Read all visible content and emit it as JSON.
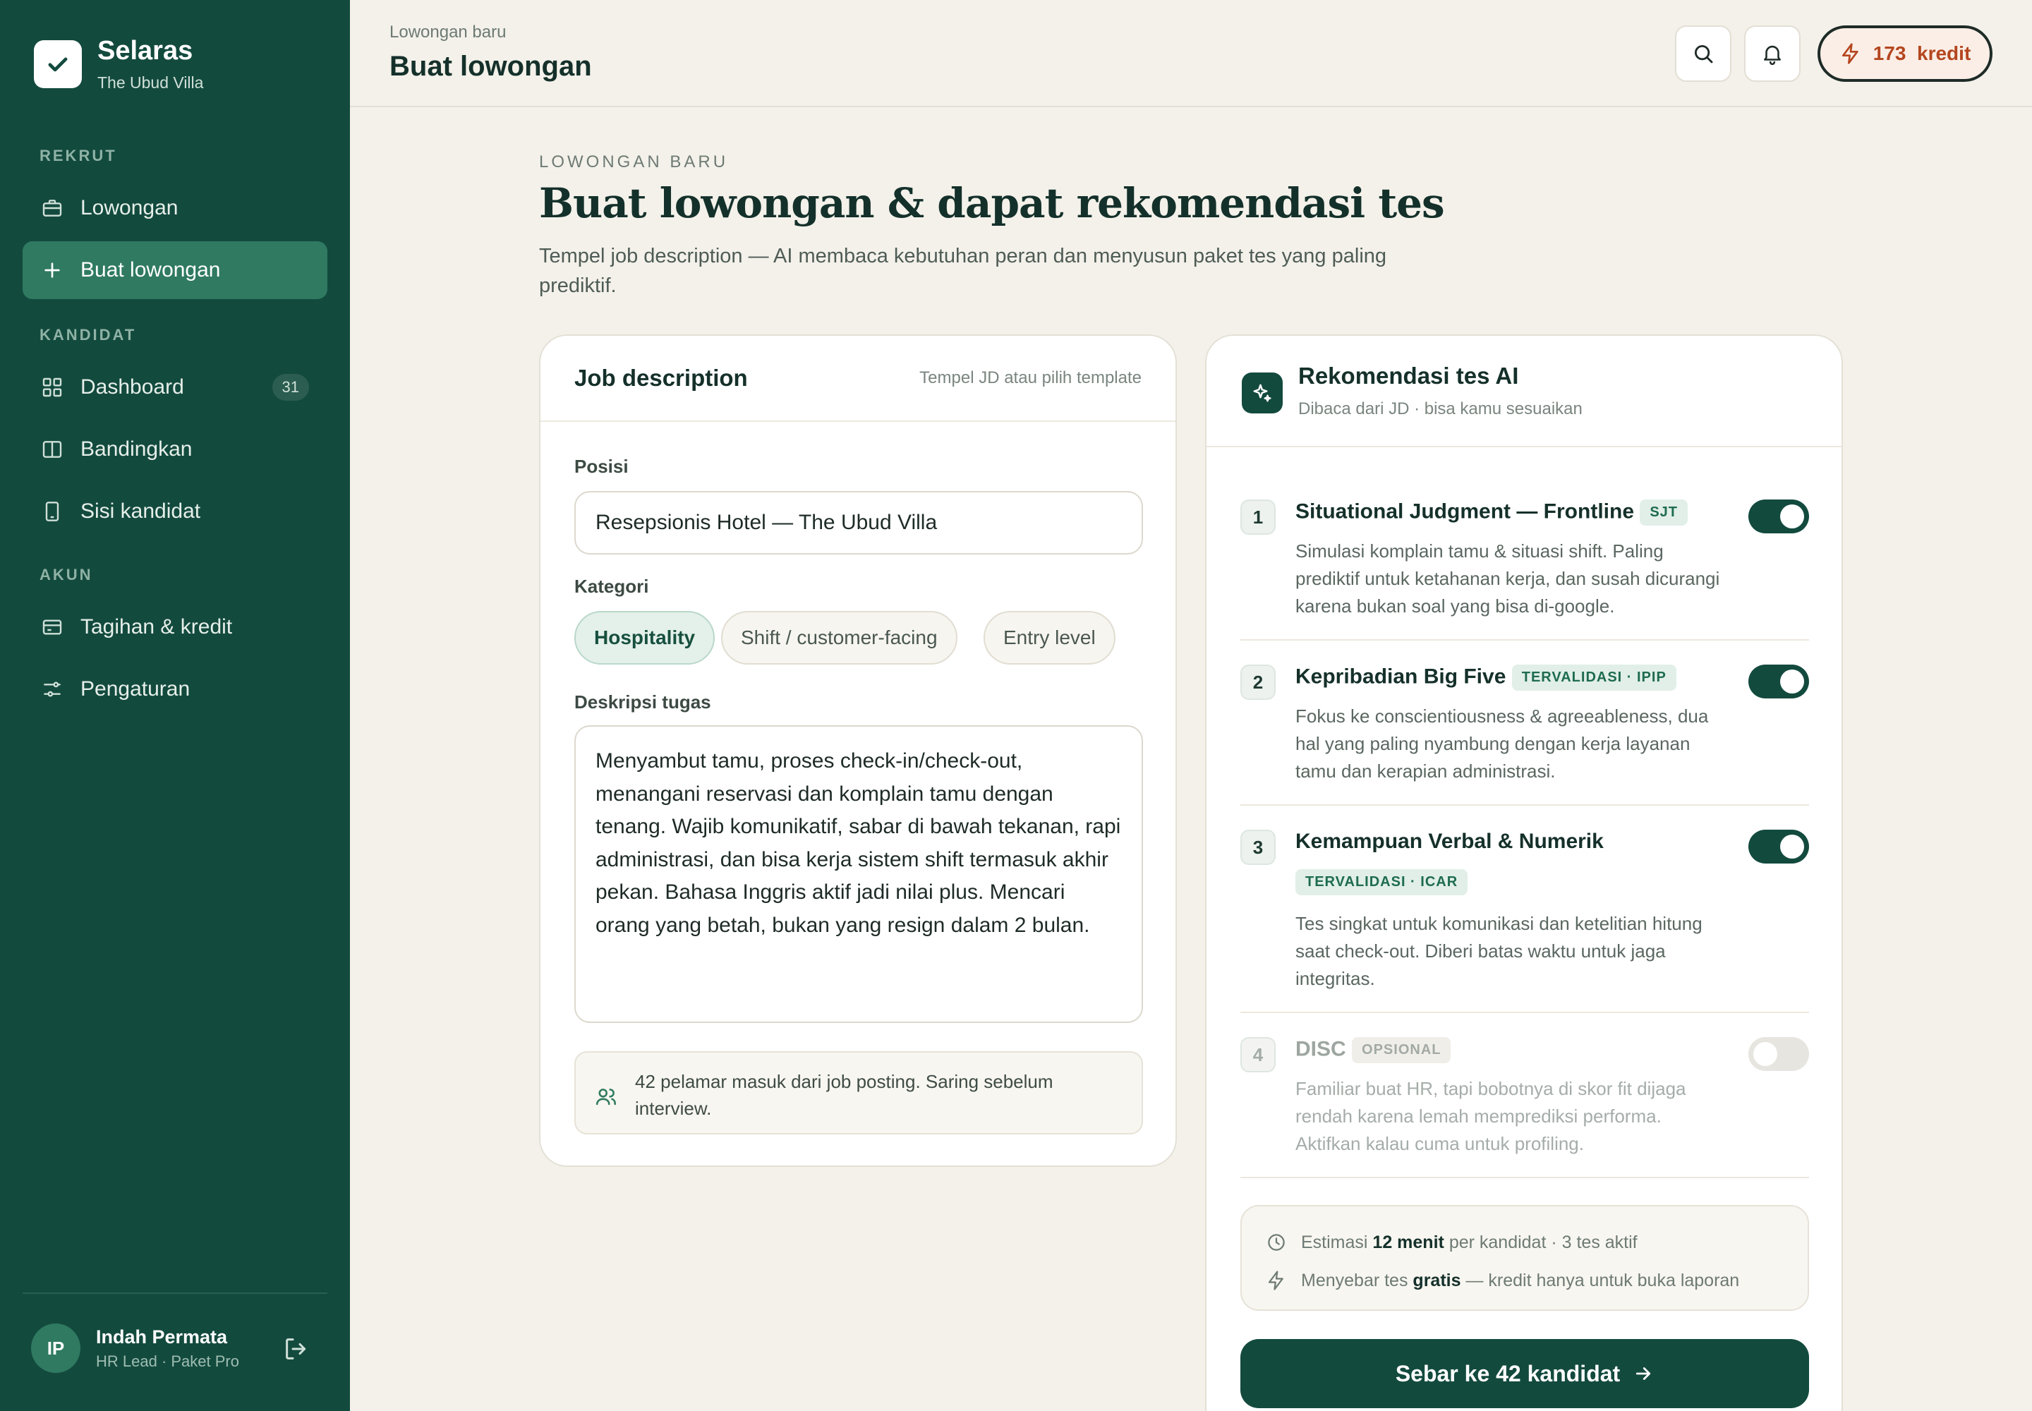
{
  "brand": {
    "name": "Selaras",
    "subtitle": "The Ubud Villa"
  },
  "sidebar": {
    "sections": [
      "REKRUT",
      "KANDIDAT",
      "AKUN"
    ],
    "items": [
      {
        "label": "Lowongan",
        "icon": "briefcase-icon"
      },
      {
        "label": "Buat lowongan",
        "icon": "plus-icon",
        "active": true
      },
      {
        "label": "Dashboard",
        "icon": "grid-icon",
        "badge": "31"
      },
      {
        "label": "Bandingkan",
        "icon": "columns-icon"
      },
      {
        "label": "Sisi kandidat",
        "icon": "phone-icon"
      },
      {
        "label": "Tagihan & kredit",
        "icon": "card-icon"
      },
      {
        "label": "Pengaturan",
        "icon": "sliders-icon"
      }
    ],
    "user": {
      "initials": "IP",
      "name": "Indah Permata",
      "role": "HR Lead · Paket Pro"
    }
  },
  "topbar": {
    "breadcrumb": "Lowongan baru",
    "title": "Buat lowongan",
    "credits_count": "173",
    "credits_label": "kredit"
  },
  "hero": {
    "eyebrow": "LOWONGAN BARU",
    "title": "Buat lowongan & dapat rekomendasi tes",
    "description": "Tempel job description — AI membaca kebutuhan peran dan menyusun paket tes yang paling prediktif."
  },
  "jd": {
    "title": "Job description",
    "hint": "Tempel JD atau pilih template",
    "position_label": "Posisi",
    "position_value": "Resepsionis Hotel — The Ubud Villa",
    "category_label": "Kategori",
    "categories": [
      "Hospitality",
      "Shift / customer-facing",
      "Entry level"
    ],
    "tasks_label": "Deskripsi tugas",
    "tasks_value": "Menyambut tamu, proses check-in/check-out, menangani reservasi dan komplain tamu dengan tenang. Wajib komunikatif, sabar di bawah tekanan, rapi administrasi, dan bisa kerja sistem shift termasuk akhir pekan. Bahasa Inggris aktif jadi nilai plus. Mencari orang yang betah, bukan yang resign dalam 2 bulan.",
    "note": "42 pelamar masuk dari job posting. Saring sebelum interview."
  },
  "rec": {
    "title": "Rekomendasi tes AI",
    "subtitle": "Dibaca dari JD · bisa kamu sesuaikan",
    "items": [
      {
        "num": "1",
        "name": "Situational Judgment — Frontline",
        "tag": "SJT",
        "desc": "Simulasi komplain tamu & situasi shift. Paling prediktif untuk ketahanan kerja, dan susah dicurangi karena bukan soal yang bisa di-google.",
        "enabled": true
      },
      {
        "num": "2",
        "name": "Kepribadian Big Five",
        "tag": "TERVALIDASI · IPIP",
        "desc": "Fokus ke conscientiousness & agreeableness, dua hal yang paling nyambung dengan kerja layanan tamu dan kerapian administrasi.",
        "enabled": true
      },
      {
        "num": "3",
        "name": "Kemampuan Verbal & Numerik",
        "tag": "TERVALIDASI · ICAR",
        "desc": "Tes singkat untuk komunikasi dan ketelitian hitung saat check-out. Diberi batas waktu untuk jaga integritas.",
        "enabled": true
      },
      {
        "num": "4",
        "name": "DISC",
        "tag": "OPSIONAL",
        "desc": "Familiar buat HR, tapi bobotnya di skor fit dijaga rendah karena lemah memprediksi performa. Aktifkan kalau cuma untuk profiling.",
        "enabled": false
      }
    ],
    "estimate": {
      "prefix": "Estimasi",
      "strong": "12 menit",
      "suffix": "per kandidat · 3 tes aktif"
    },
    "free": {
      "prefix": "Menyebar tes",
      "strong": "gratis",
      "suffix": "— kredit hanya untuk buka laporan"
    },
    "cta": "Sebar ke 42 kandidat"
  },
  "colors": {
    "sidebar": "#134a3e",
    "accent": "#2f7a60",
    "credit": "#b4461f",
    "background": "#f3f1ea"
  }
}
